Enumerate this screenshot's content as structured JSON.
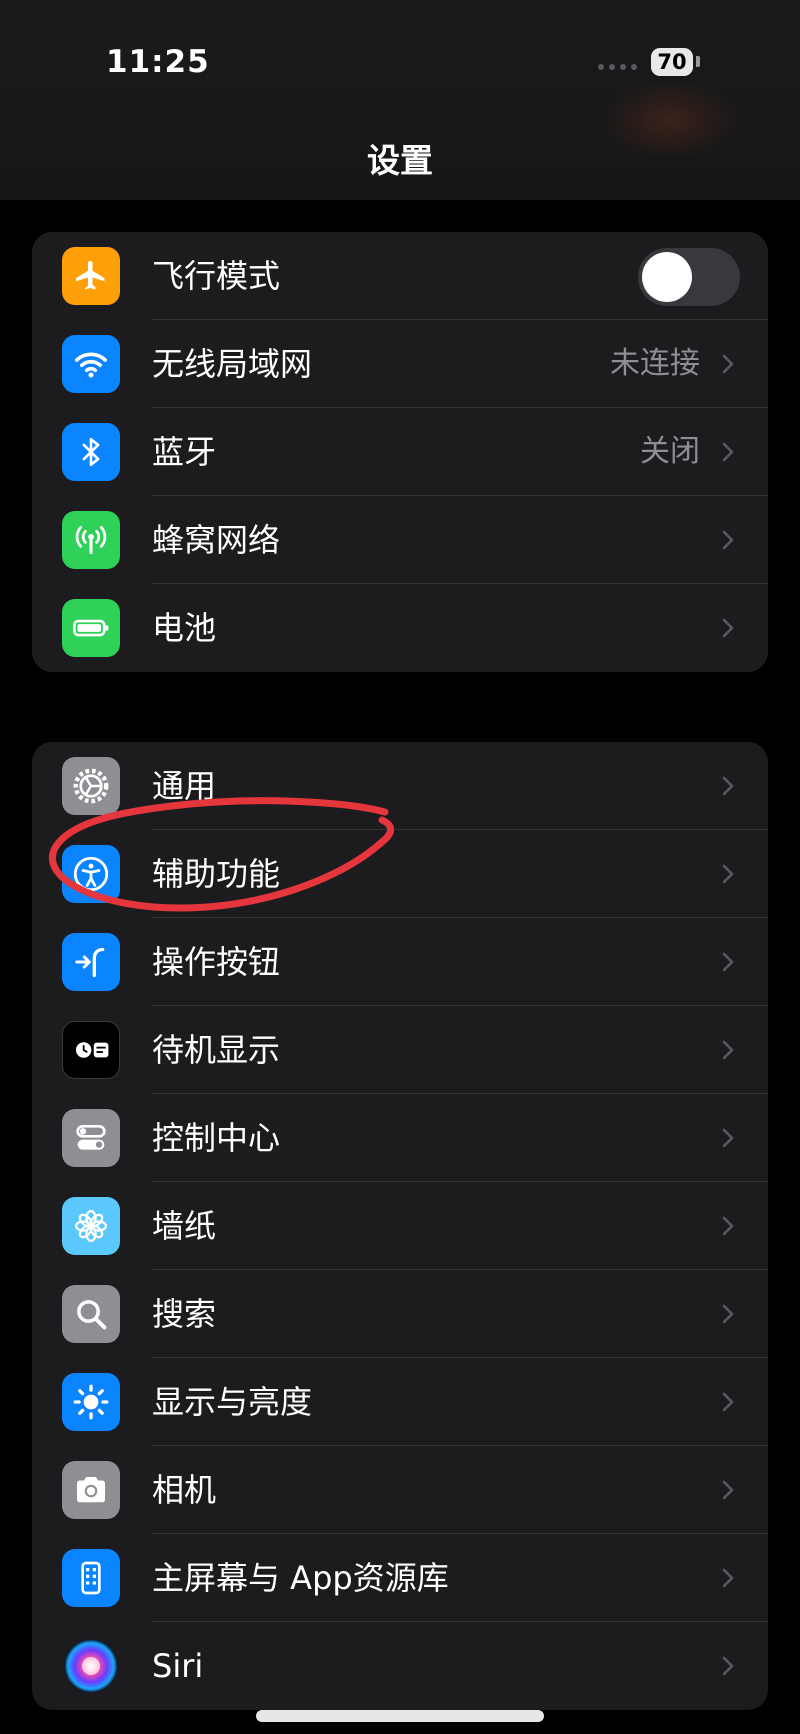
{
  "status_bar": {
    "time": "11:25",
    "battery_level": "70"
  },
  "header": {
    "title": "设置"
  },
  "group1": {
    "items": [
      {
        "label": "飞行模式",
        "icon": "airplane-icon",
        "color": "#ff9f0a",
        "toggle_on": false
      },
      {
        "label": "无线局域网",
        "value": "未连接",
        "icon": "wifi-icon",
        "color": "#0a84ff"
      },
      {
        "label": "蓝牙",
        "value": "关闭",
        "icon": "bluetooth-icon",
        "color": "#0a84ff"
      },
      {
        "label": "蜂窝网络",
        "icon": "cellular-icon",
        "color": "#30d158"
      },
      {
        "label": "电池",
        "icon": "battery-icon",
        "color": "#30d158"
      }
    ]
  },
  "group2": {
    "items": [
      {
        "label": "通用",
        "icon": "gear-icon",
        "color": "#8e8e93"
      },
      {
        "label": "辅助功能",
        "icon": "accessibility-icon",
        "color": "#0a84ff"
      },
      {
        "label": "操作按钮",
        "icon": "action-button-icon",
        "color": "#0a84ff"
      },
      {
        "label": "待机显示",
        "icon": "standby-icon",
        "color": "#000000"
      },
      {
        "label": "控制中心",
        "icon": "control-center-icon",
        "color": "#8e8e93"
      },
      {
        "label": "墙纸",
        "icon": "wallpaper-icon",
        "color": "#5ac8fa"
      },
      {
        "label": "搜索",
        "icon": "search-icon",
        "color": "#8e8e93"
      },
      {
        "label": "显示与亮度",
        "icon": "brightness-icon",
        "color": "#0a84ff"
      },
      {
        "label": "相机",
        "icon": "camera-icon",
        "color": "#8e8e93"
      },
      {
        "label": "主屏幕与 App资源库",
        "icon": "home-screen-icon",
        "color": "#0a84ff"
      },
      {
        "label": "Siri",
        "icon": "siri-icon",
        "color": "#1c1c1e"
      }
    ]
  },
  "annotation_color": "#e5363d"
}
